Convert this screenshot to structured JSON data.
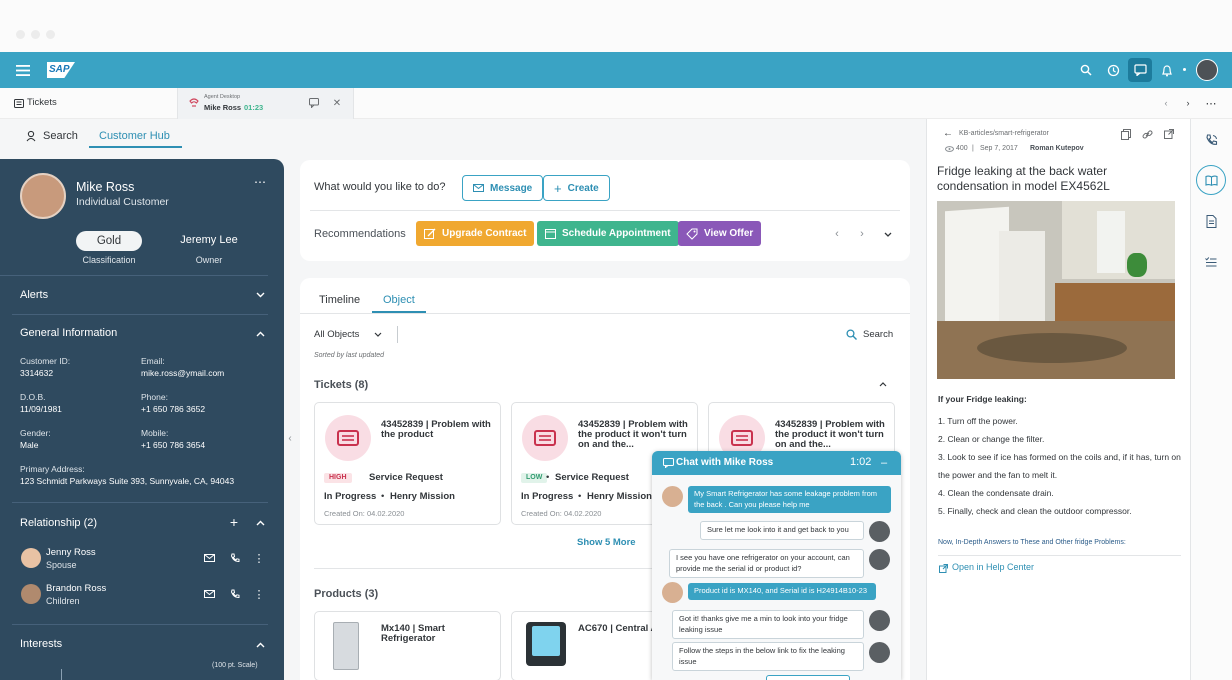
{
  "shell": {
    "logo": "SAP"
  },
  "tabs": {
    "tickets": "Tickets",
    "active_sup": "Agent Desktop",
    "active_name": "Mike Ross",
    "active_time": "01:23"
  },
  "subnav": {
    "search": "Search",
    "hub": "Customer Hub"
  },
  "customer": {
    "name": "Mike Ross",
    "type": "Individual Customer",
    "classification": "Gold",
    "classification_label": "Classification",
    "owner": "Jeremy Lee",
    "owner_label": "Owner"
  },
  "sections": {
    "alerts": "Alerts",
    "general": "General Information",
    "relationship": "Relationship (2)",
    "interests": "Interests",
    "scale": "(100 pt. Scale)"
  },
  "general": {
    "id_label": "Customer ID:",
    "id": "3314632",
    "email_label": "Email:",
    "email": "mike.ross@ymail.com",
    "dob_label": "D.O.B.",
    "dob": "11/09/1981",
    "phone_label": "Phone:",
    "phone": "+1 650 786 3652",
    "gender_label": "Gender:",
    "gender": "Male",
    "mobile_label": "Mobile:",
    "mobile": "+1 650 786 3654",
    "address_label": "Primary Address:",
    "address": "123 Schmidt Parkways Suite 393, Sunnyvale, CA, 94043"
  },
  "relations": [
    {
      "name": "Jenny Ross",
      "role": "Spouse"
    },
    {
      "name": "Brandon Ross",
      "role": "Children"
    }
  ],
  "actions": {
    "question": "What would you like to do?",
    "message": "Message",
    "create": "Create",
    "recs_label": "Recommendations",
    "upgrade": "Upgrade Contract",
    "schedule": "Schedule Appointment",
    "offer": "View Offer",
    "colors": {
      "upgrade": "#f0a830",
      "schedule": "#3fb58e",
      "offer": "#8a58b8"
    }
  },
  "object": {
    "tab_timeline": "Timeline",
    "tab_object": "Object",
    "filter": "All Objects",
    "search": "Search",
    "sorted": "Sorted by last updated",
    "tickets_title": "Tickets (8)",
    "show_more": "Show 5 More",
    "products_title": "Products (3)"
  },
  "tickets": [
    {
      "title": "43452839 | Problem with the product",
      "priority": "HIGH",
      "type": "Service Request",
      "status": "In Progress",
      "assignee": "Henry Mission",
      "created": "Created On: 04.02.2020"
    },
    {
      "title": "43452839 | Problem with the product it won't turn on and the...",
      "priority": "LOW",
      "type": "Service Request",
      "status": "In Progress",
      "assignee": "Henry Mission",
      "created": "Created On: 04.02.2020"
    },
    {
      "title": "43452839 | Problem with the product it won't turn on and the..."
    }
  ],
  "products": [
    {
      "title": "Mx140 | Smart Refrigerator"
    },
    {
      "title": "AC670 | Central Air Conditioner Cabinet",
      "title_visible": "AC670 | Central A... Conditioner Cabi..."
    }
  ],
  "chat": {
    "title": "Chat with Mike Ross",
    "timer": "1:02",
    "messages": [
      {
        "from": "customer",
        "text": "My Smart Refrigerator has some leakage problem from the back . Can you please help me"
      },
      {
        "from": "agent",
        "text": "Sure let me look into it and get back to you"
      },
      {
        "from": "agent",
        "text": "I see you have one refrigerator on your account, can provide me the serial id or product id?"
      },
      {
        "from": "customer",
        "text": "Product id is MX140, and Serial id is H24914B10-23"
      },
      {
        "from": "agent",
        "text": "Got it! thanks give me a min to look into your  fridge leaking issue"
      },
      {
        "from": "agent",
        "text": "Follow the steps in the below link to fix the leaking issue"
      }
    ]
  },
  "kb": {
    "path": "KB-articles/smart-refrigerator",
    "views": "400",
    "date": "Sep 7, 2017",
    "author": "Roman Kutepov",
    "title": "Fridge leaking at the back water condensation in model EX4562L",
    "intro": "If your Fridge leaking:",
    "steps": [
      "1. Turn off the power.",
      "2. Clean or change the filter.",
      "3. Look to see if ice has formed on the coils and, if it has, turn on the power and the fan to melt it.",
      "4. Clean the condensate drain.",
      "5. Finally, check and clean the outdoor compressor."
    ],
    "more": "Now, In-Depth Answers to These and Other fridge Problems:",
    "help_link": "Open in Help Center"
  }
}
